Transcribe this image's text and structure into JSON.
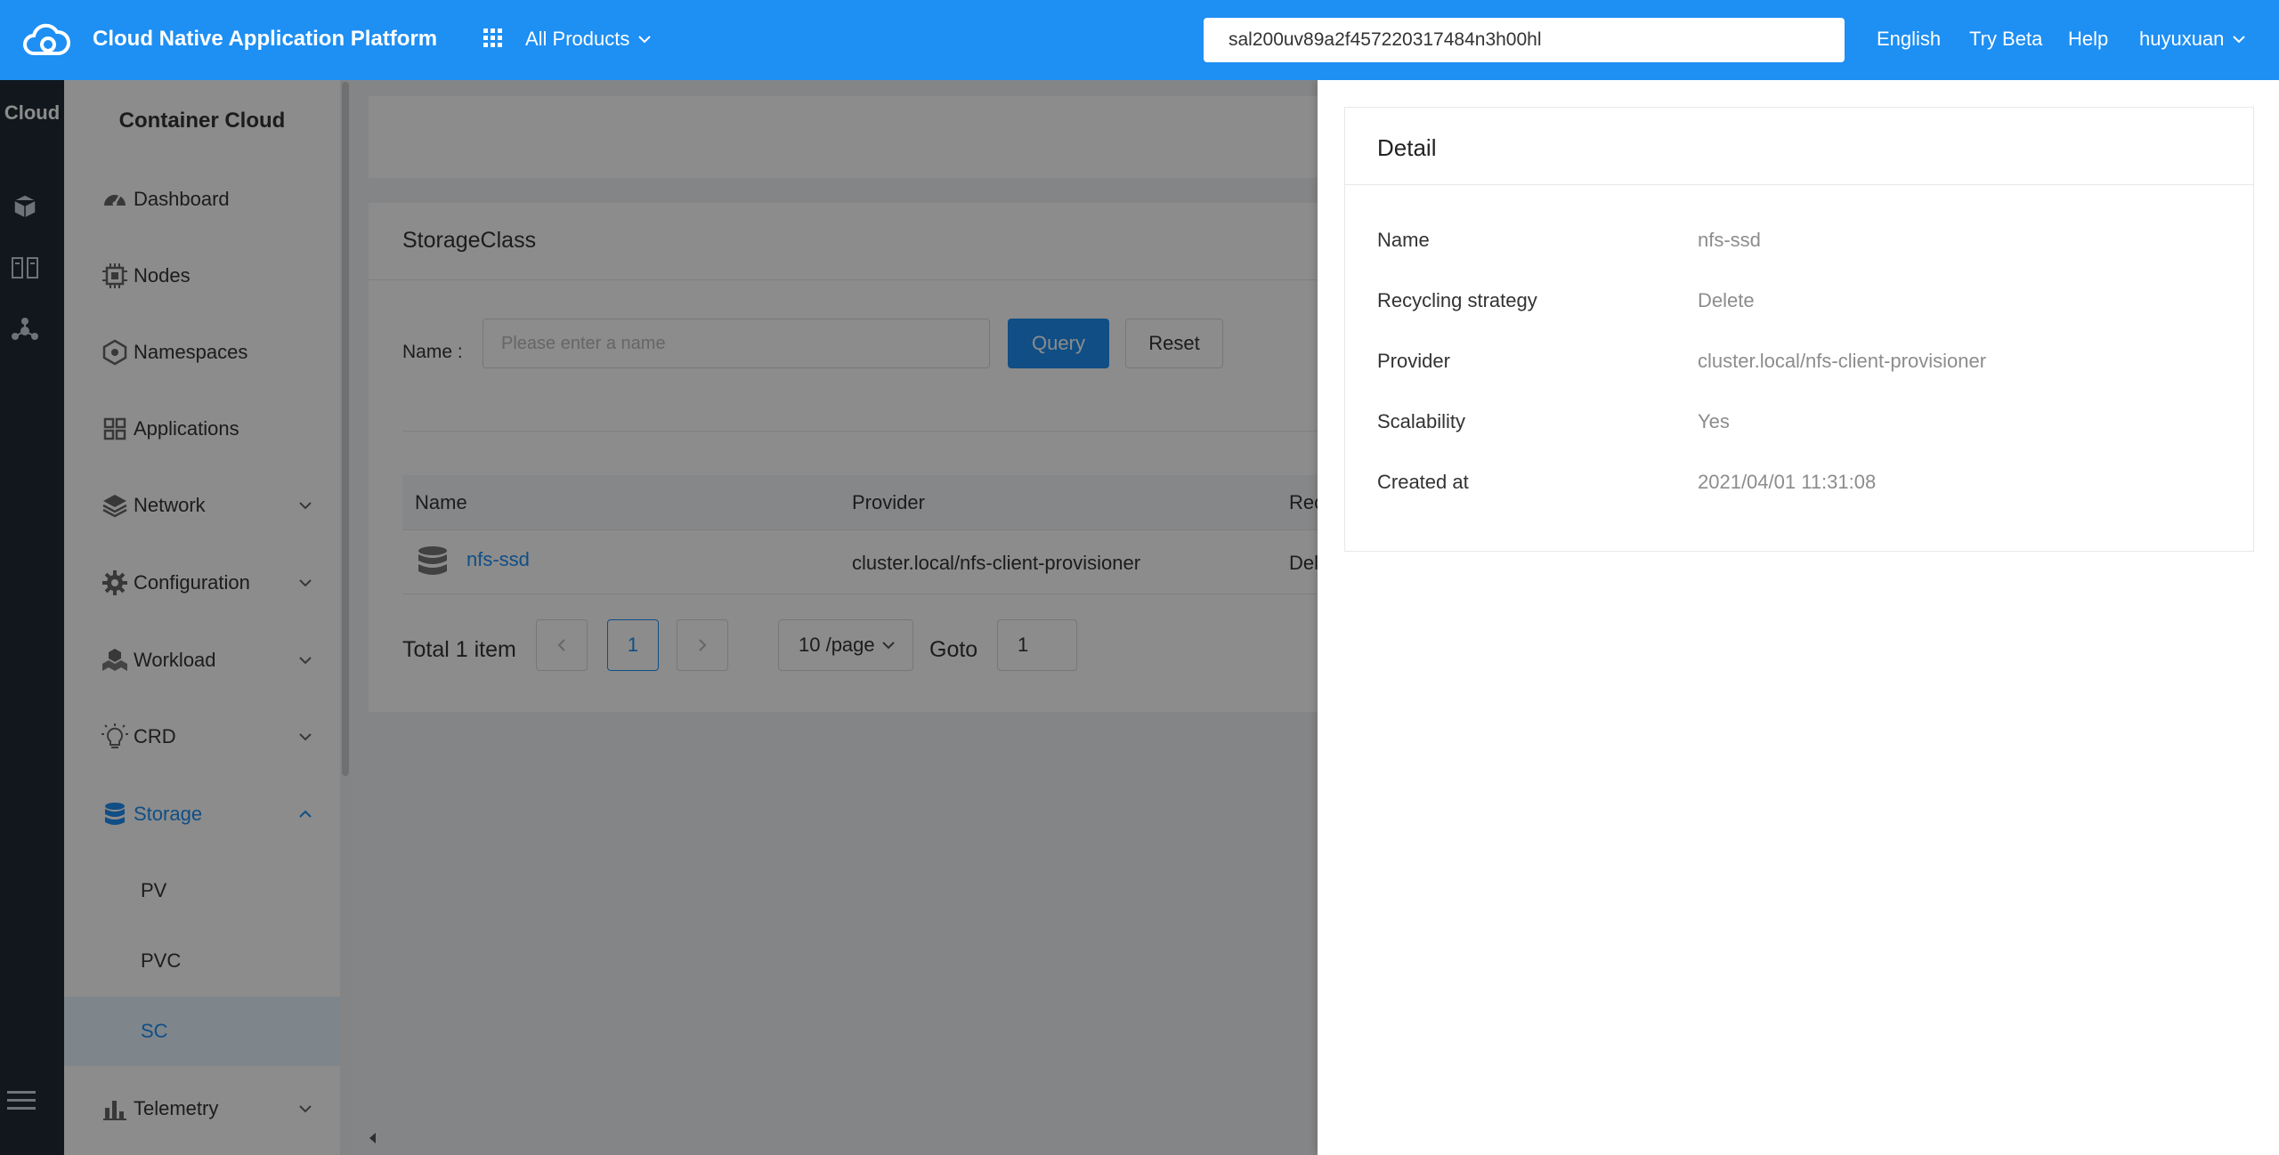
{
  "colors": {
    "primary": "#1e8ff3",
    "rail": "#1f2a34",
    "muted": "#8c8c8c"
  },
  "topbar": {
    "title": "Cloud Native Application Platform",
    "products_label": "All Products",
    "search_value": "sal200uv89a2f457220317484n3h00hl",
    "language": "English",
    "try_beta": "Try Beta",
    "help": "Help",
    "user": "huyuxuan"
  },
  "rail": {
    "title": "Cloud"
  },
  "sidebar": {
    "title": "Container Cloud",
    "items": [
      {
        "label": "Dashboard",
        "icon": "dashboard-icon"
      },
      {
        "label": "Nodes",
        "icon": "chip-icon"
      },
      {
        "label": "Namespaces",
        "icon": "hexagon-icon"
      },
      {
        "label": "Applications",
        "icon": "apps-grid-icon"
      },
      {
        "label": "Network",
        "icon": "layers-icon",
        "expandable": true
      },
      {
        "label": "Configuration",
        "icon": "gear-icon",
        "expandable": true
      },
      {
        "label": "Workload",
        "icon": "cubes-icon",
        "expandable": true
      },
      {
        "label": "CRD",
        "icon": "bulb-icon",
        "expandable": true
      },
      {
        "label": "Storage",
        "icon": "database-icon",
        "expandable": true,
        "expanded": true
      },
      {
        "label": "Telemetry",
        "icon": "bar-chart-icon",
        "expandable": true
      }
    ],
    "storage_children": [
      {
        "label": "PV"
      },
      {
        "label": "PVC"
      },
      {
        "label": "SC",
        "selected": true
      }
    ]
  },
  "main": {
    "card_title": "StorageClass",
    "filter": {
      "label": "Name :",
      "placeholder": "Please enter a name",
      "query": "Query",
      "reset": "Reset"
    },
    "table": {
      "columns": [
        "Name",
        "Provider",
        "Rec"
      ],
      "rows": [
        {
          "name": "nfs-ssd",
          "provider": "cluster.local/nfs-client-provisioner",
          "reclaim": "Del"
        }
      ]
    },
    "pagination": {
      "total": "Total 1 item",
      "current_page": "1",
      "page_size": "10 /page",
      "goto_label": "Goto",
      "goto_value": "1"
    }
  },
  "detail": {
    "title": "Detail",
    "fields": [
      {
        "key": "Name",
        "value": "nfs-ssd"
      },
      {
        "key": "Recycling strategy",
        "value": "Delete"
      },
      {
        "key": "Provider",
        "value": "cluster.local/nfs-client-provisioner"
      },
      {
        "key": "Scalability",
        "value": "Yes"
      },
      {
        "key": "Created at",
        "value": "2021/04/01 11:31:08"
      }
    ]
  }
}
